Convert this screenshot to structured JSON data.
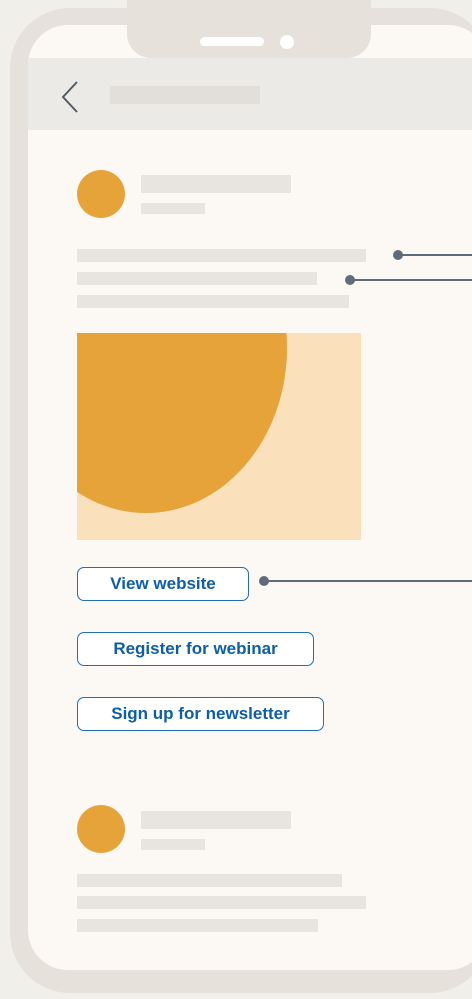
{
  "post": {
    "buttons": [
      {
        "label": "View website"
      },
      {
        "label": "Register for webinar"
      },
      {
        "label": "Sign up for newsletter"
      }
    ]
  },
  "colors": {
    "accent_orange": "#e6a33a",
    "image_bg": "#fbe1bb",
    "button_border": "#1f6fb2",
    "button_text": "#0d5ea6",
    "screen_bg": "#fcf8f3",
    "frame": "#e6e2db"
  },
  "icons": {
    "back": "chevron-left-icon"
  }
}
